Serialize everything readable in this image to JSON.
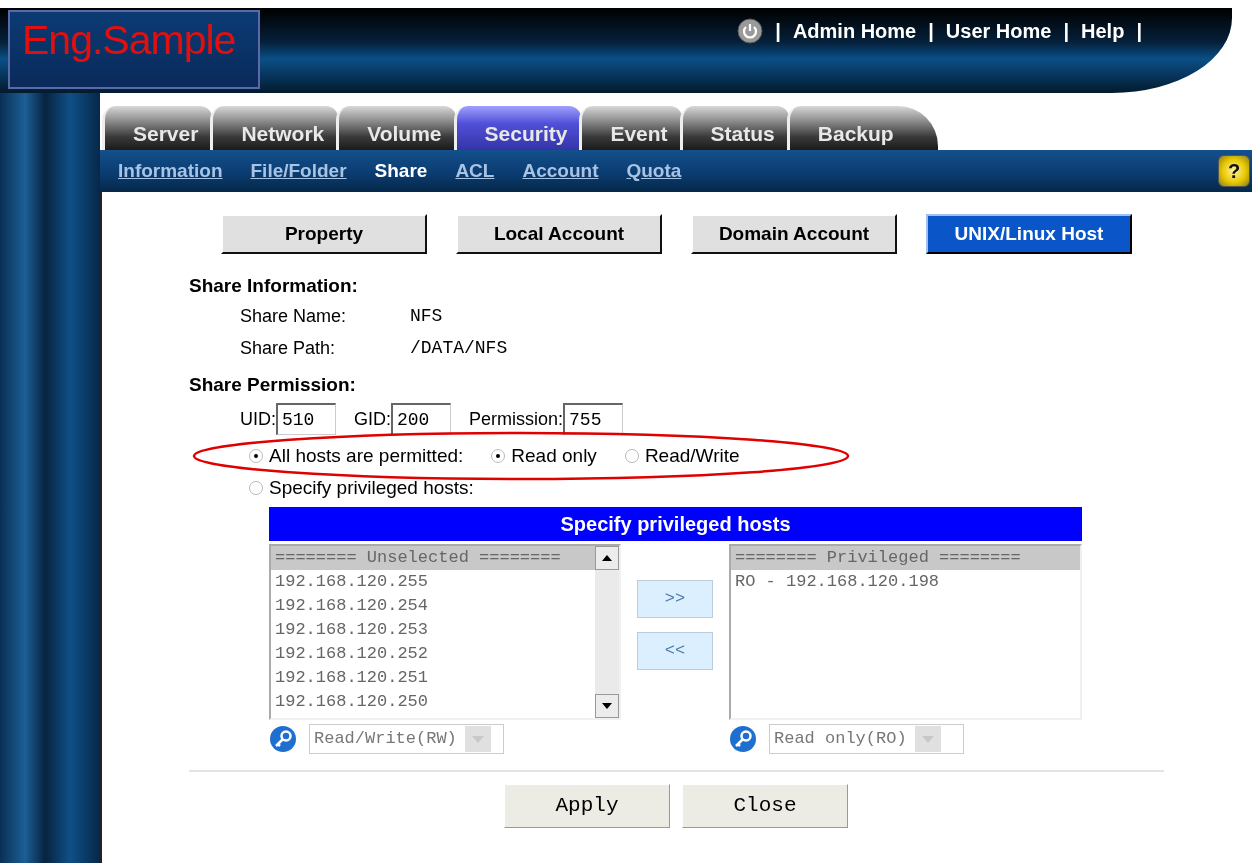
{
  "header": {
    "logo": "Eng.Sample",
    "items": [
      {
        "kind": "power"
      },
      {
        "kind": "separator",
        "text": "|"
      },
      {
        "kind": "link",
        "text": "Admin Home"
      },
      {
        "kind": "separator",
        "text": "|"
      },
      {
        "kind": "link",
        "text": "User Home"
      },
      {
        "kind": "separator",
        "text": "|"
      },
      {
        "kind": "link",
        "text": "Help"
      },
      {
        "kind": "separator",
        "text": "|"
      }
    ]
  },
  "main_tabs": [
    {
      "label": "Server",
      "selected": false
    },
    {
      "label": "Network",
      "selected": false
    },
    {
      "label": "Volume",
      "selected": false
    },
    {
      "label": "Security",
      "selected": true
    },
    {
      "label": "Event",
      "selected": false
    },
    {
      "label": "Status",
      "selected": false
    },
    {
      "label": "Backup",
      "selected": false
    }
  ],
  "sub_tabs": [
    {
      "label": "Information",
      "selected": false
    },
    {
      "label": "File/Folder",
      "selected": false
    },
    {
      "label": "Share",
      "selected": true
    },
    {
      "label": "ACL",
      "selected": false
    },
    {
      "label": "Account",
      "selected": false
    },
    {
      "label": "Quota",
      "selected": false
    }
  ],
  "help_button": "?",
  "section_buttons": [
    {
      "label": "Property",
      "selected": false
    },
    {
      "label": "Local Account",
      "selected": false
    },
    {
      "label": "Domain Account",
      "selected": false
    },
    {
      "label": "UNIX/Linux Host",
      "selected": true
    }
  ],
  "share_information": {
    "title": "Share Information:",
    "fields": [
      {
        "label": "Share Name:",
        "value": "NFS"
      },
      {
        "label": "Share Path:",
        "value": "/DATA/NFS"
      }
    ]
  },
  "share_permission": {
    "title": "Share Permission:",
    "ids": [
      {
        "label": "UID:",
        "value": "510"
      },
      {
        "label": "GID:",
        "value": "200"
      },
      {
        "label": "Permission:",
        "value": "755"
      }
    ],
    "all_hosts": {
      "label": "All hosts are permitted:",
      "selected": true,
      "modes": [
        {
          "label": "Read only",
          "selected": true
        },
        {
          "label": "Read/Write",
          "selected": false
        }
      ]
    },
    "specify_hosts": {
      "label": "Specify privileged hosts:",
      "selected": false
    }
  },
  "hosts_panel": {
    "title": "Specify privileged hosts",
    "unselected": {
      "header": "======== Unselected ========",
      "items": [
        "192.168.120.255",
        "192.168.120.254",
        "192.168.120.253",
        "192.168.120.252",
        "192.168.120.251",
        "192.168.120.250"
      ],
      "access": "Read/Write(RW)"
    },
    "move_buttons": [
      {
        "label": ">>",
        "disabled": true
      },
      {
        "label": "<<",
        "disabled": true
      }
    ],
    "privileged": {
      "header": "======== Privileged ========",
      "items": [
        "RO - 192.168.120.198"
      ],
      "access": "Read only(RO)"
    }
  },
  "actions": [
    "Apply",
    "Close"
  ]
}
